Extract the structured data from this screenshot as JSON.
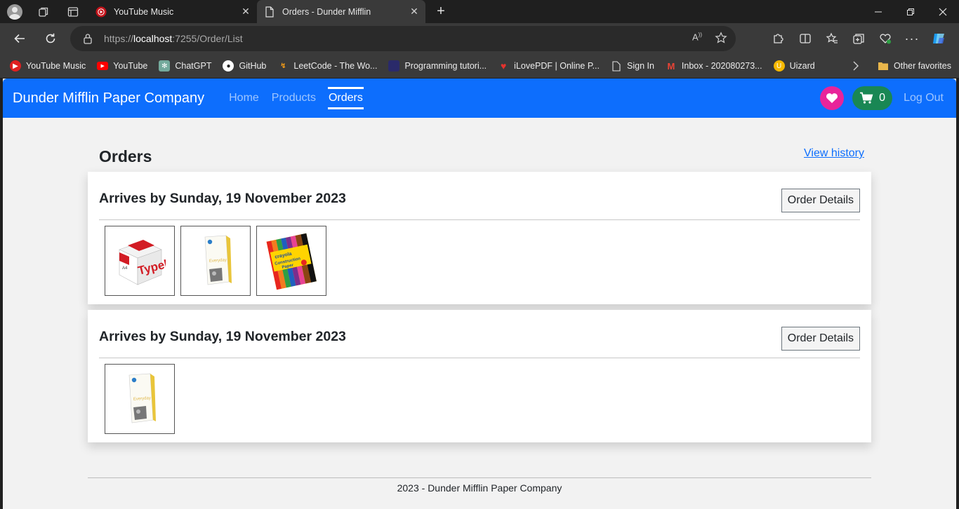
{
  "browser": {
    "tabs": [
      {
        "title": "YouTube Music",
        "active": false
      },
      {
        "title": "Orders - Dunder Mifflin",
        "active": true
      }
    ],
    "url_prefix": "https://",
    "url_host": "localhost",
    "url_rest": ":7255/Order/List",
    "bookmarks": [
      {
        "label": "YouTube Music",
        "icon": "youtube-music-icon",
        "color": "#e02020"
      },
      {
        "label": "YouTube",
        "icon": "youtube-icon",
        "color": "#ff0000"
      },
      {
        "label": "ChatGPT",
        "icon": "chatgpt-icon",
        "color": "#74aa9c"
      },
      {
        "label": "GitHub",
        "icon": "github-icon",
        "color": "#ffffff"
      },
      {
        "label": "LeetCode - The Wo...",
        "icon": "leetcode-icon",
        "color": "#ffa116"
      },
      {
        "label": "Programming tutori...",
        "icon": "tutorial-icon",
        "color": "#2a2a6a"
      },
      {
        "label": "iLovePDF | Online P...",
        "icon": "ilovepdf-icon",
        "color": "#e5322d"
      },
      {
        "label": "Sign In",
        "icon": "page-icon",
        "color": "#ffffff"
      },
      {
        "label": "Inbox - 202080273...",
        "icon": "gmail-icon",
        "color": "#ea4335"
      },
      {
        "label": "Uizard",
        "icon": "uizard-icon",
        "color": "#f5b800"
      }
    ],
    "other_favorites": "Other favorites"
  },
  "app": {
    "brand": "Dunder Mifflin Paper Company",
    "nav": {
      "home": "Home",
      "products": "Products",
      "orders": "Orders"
    },
    "cart_count": "0",
    "logout": "Log Out",
    "primary_color": "#0d6efd"
  },
  "orders_page": {
    "title": "Orders",
    "history_link": "View history",
    "orders": [
      {
        "arrives": "Arrives by Sunday, 19 November 2023",
        "details_button": "Order Details",
        "items": [
          "typek-paper-box",
          "hp-everyday-paper",
          "crayola-construction-paper"
        ]
      },
      {
        "arrives": "Arrives by Sunday, 19 November 2023",
        "details_button": "Order Details",
        "items": [
          "hp-everyday-paper"
        ]
      }
    ]
  },
  "footer": "2023 - Dunder Mifflin Paper Company"
}
